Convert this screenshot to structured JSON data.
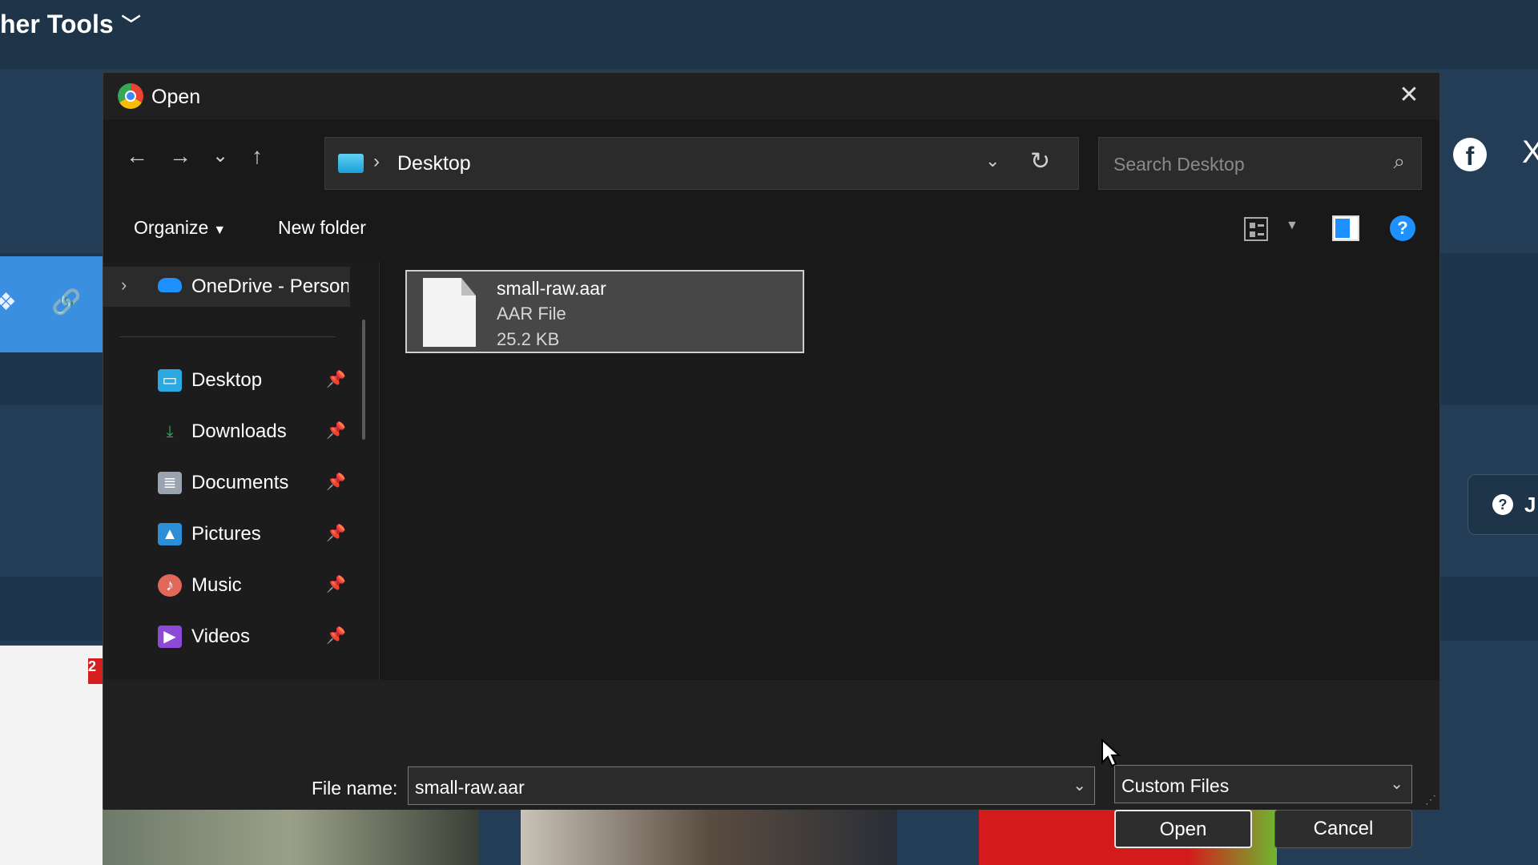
{
  "background": {
    "header_title": "her Tools",
    "header_chevron": "﹀",
    "badge_text": "2",
    "help_pill_text": "J",
    "facebook_glyph": "f",
    "x_glyph": "X"
  },
  "dialog": {
    "title": "Open",
    "close_glyph": "✕",
    "nav": {
      "back": "←",
      "forward": "→",
      "recent": "⌄",
      "up": "↑"
    },
    "address": {
      "separator": "›",
      "path": "Desktop",
      "dropdown": "⌄",
      "refresh": "↻"
    },
    "search": {
      "placeholder": "Search Desktop",
      "icon": "⌕"
    },
    "toolbar": {
      "organize_label": "Organize",
      "organize_caret": "▼",
      "new_folder_label": "New folder",
      "view_caret": "▼",
      "help_glyph": "?"
    },
    "sidebar": {
      "onedrive_label": "OneDrive - Personal",
      "expand_glyph": "›",
      "pin_glyph": "📌",
      "items": [
        {
          "label": "Desktop",
          "icon": "desktop-icon",
          "color": "#2aa8e0"
        },
        {
          "label": "Downloads",
          "icon": "downloads-icon",
          "color": "#2fb36b"
        },
        {
          "label": "Documents",
          "icon": "documents-icon",
          "color": "#9aa4b0"
        },
        {
          "label": "Pictures",
          "icon": "pictures-icon",
          "color": "#2b8fd8"
        },
        {
          "label": "Music",
          "icon": "music-icon",
          "color": "#e2685a"
        },
        {
          "label": "Videos",
          "icon": "videos-icon",
          "color": "#8d4ad6"
        }
      ],
      "icon_glyphs": [
        "▭",
        "⤓",
        "≣",
        "▲",
        "♪",
        "▶"
      ]
    },
    "files": [
      {
        "name": "small-raw.aar",
        "type": "AAR File",
        "size": "25.2 KB"
      }
    ],
    "footer": {
      "file_name_label": "File name:",
      "file_name_value": "small-raw.aar",
      "file_type_value": "Custom Files",
      "dropdown_glyph": "⌄",
      "open_label": "Open",
      "cancel_label": "Cancel",
      "grip_glyph": "⋰"
    }
  }
}
